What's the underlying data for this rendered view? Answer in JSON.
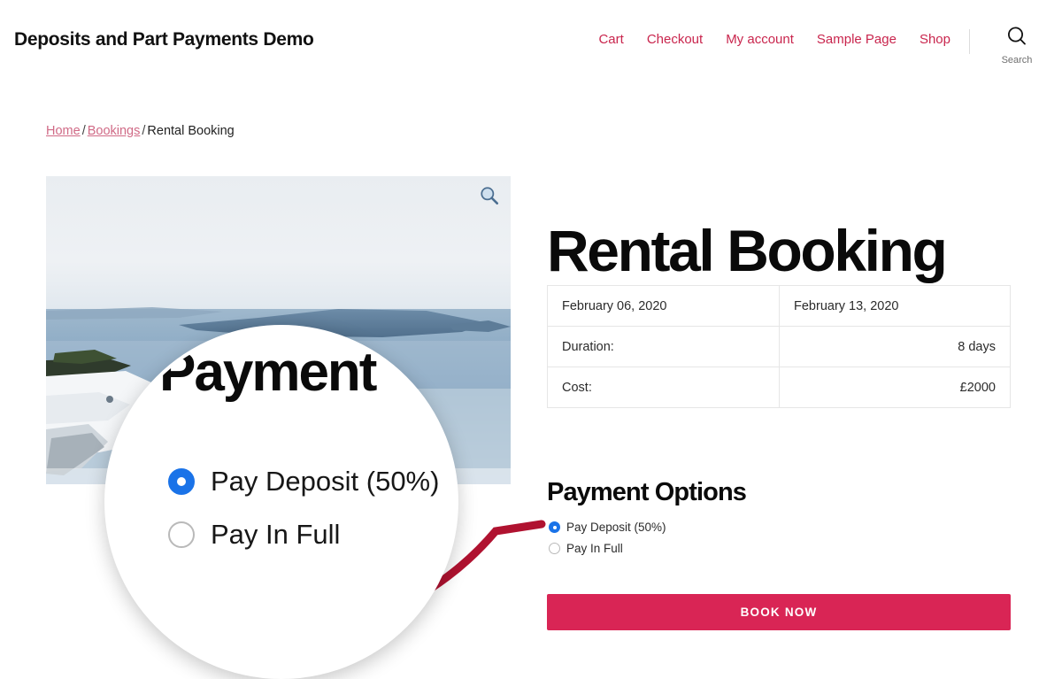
{
  "header": {
    "site_title": "Deposits and Part Payments Demo",
    "nav": [
      {
        "label": "Cart"
      },
      {
        "label": "Checkout"
      },
      {
        "label": "My account"
      },
      {
        "label": "Sample Page"
      },
      {
        "label": "Shop"
      }
    ],
    "search": {
      "label": "Search",
      "icon": "search-icon"
    },
    "link_color": "#c9254d"
  },
  "breadcrumb": {
    "home": "Home",
    "parent": "Bookings",
    "current": "Rental Booking",
    "separator": "/"
  },
  "product": {
    "image_alt": "Santorini sea view with white terraces",
    "zoom_icon": "magnifier-icon",
    "title": "Rental Booking",
    "table": {
      "rows": [
        {
          "label": "February 06, 2020",
          "value": "February 13, 2020",
          "align": "left"
        },
        {
          "label": "Duration:",
          "value": "8 days",
          "align": "right"
        },
        {
          "label": "Cost:",
          "value": "£2000",
          "align": "right"
        }
      ]
    }
  },
  "payment": {
    "heading": "Payment Options",
    "options": [
      {
        "label": "Pay Deposit (50%)",
        "selected": true
      },
      {
        "label": "Pay In Full",
        "selected": false
      }
    ],
    "selected_color": "#1a73e8",
    "book_now_label": "BOOK NOW",
    "button_color": "#d92555"
  },
  "callout": {
    "magnified_heading": "Payment",
    "magnified_options": [
      {
        "label": "Pay Deposit (50%)",
        "selected": true
      },
      {
        "label": "Pay In Full",
        "selected": false
      }
    ],
    "arrow_color": "#b01230"
  }
}
